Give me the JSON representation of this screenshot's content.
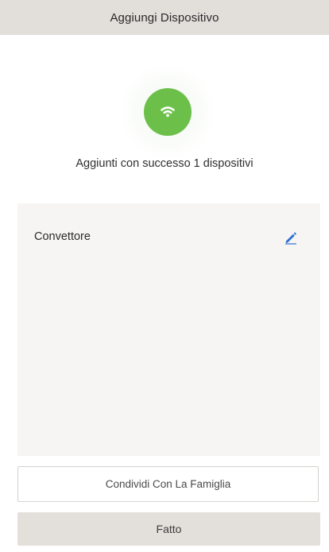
{
  "header": {
    "title": "Aggiungi Dispositivo"
  },
  "status": {
    "icon": "wifi-icon",
    "message": "Aggiunti con successo 1 dispositivi"
  },
  "devices": [
    {
      "name": "Convettore",
      "action_icon": "pencil-edit-icon"
    }
  ],
  "buttons": {
    "share_label": "Condividi Con La Famiglia",
    "done_label": "Fatto"
  },
  "colors": {
    "success_green": "#6cc04a",
    "edit_blue": "#2f6fd0",
    "header_bg": "#e2dfdb",
    "card_bg": "#f6f5f4",
    "done_bg": "#e3dfdb"
  }
}
